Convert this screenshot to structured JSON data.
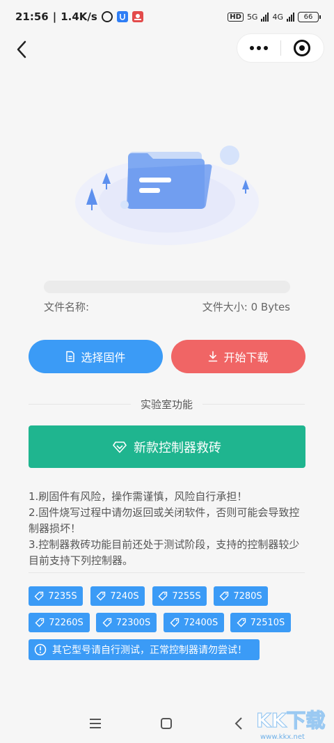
{
  "status_bar": {
    "time": "21:56",
    "speed": "1.4K/s",
    "hd_label": "HD",
    "net1": "5G",
    "net2": "4G",
    "battery": "66",
    "icons": [
      "alarm-icon",
      "blue-app-icon",
      "red-app-icon",
      "signal-icon",
      "battery-icon"
    ]
  },
  "nav": {
    "back_icon": "chevron-left-icon",
    "more_icon": "more-dots-icon",
    "close_icon": "target-circle-icon"
  },
  "file": {
    "progress": 0,
    "name_label": "文件名称:",
    "size_label": "文件大小: 0 Bytes"
  },
  "buttons": {
    "select_label": "选择固件",
    "download_label": "开始下载"
  },
  "lab": {
    "title": "实验室功能",
    "rescue_label": "新款控制器救砖"
  },
  "notes": [
    "1.刷固件有风险，操作需谨慎，风险自行承担！",
    "2.固件烧写过程中请勿返回或关闭软件，否则可能会导致控制器损坏！",
    "3.控制器救砖功能目前还处于测试阶段，支持的控制器较少目前支持下列控制器。"
  ],
  "tags": [
    "7235S",
    "7240S",
    "7255S",
    "7280S",
    "72260S",
    "72300S",
    "72400S",
    "72510S"
  ],
  "warning": "其它型号请自行测试，正常控制器请勿尝试！",
  "watermark": {
    "text": "KK下载",
    "url": "www.kkx.net"
  },
  "colors": {
    "primary_blue": "#3b9bf6",
    "danger_red": "#f06565",
    "rescue_green": "#1fb58f"
  }
}
